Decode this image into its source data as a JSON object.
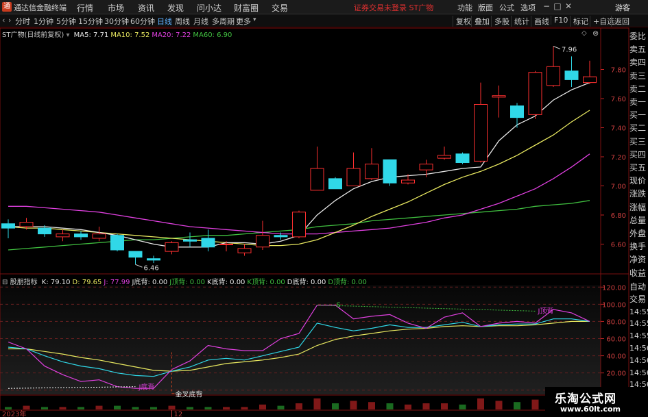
{
  "titlebar": {
    "app_title": "通达信金融终端",
    "menu": [
      "行情",
      "市场",
      "资讯",
      "发现",
      "问小达",
      "财富圈",
      "交易"
    ],
    "warning": "证券交易未登录  ST广物",
    "right_menu": [
      "功能",
      "版面",
      "公式",
      "选项"
    ],
    "guest": "游客"
  },
  "period_bar": {
    "periods": [
      "分时",
      "1分钟",
      "5分钟",
      "15分钟",
      "30分钟",
      "60分钟",
      "日线",
      "周线",
      "月线",
      "多周期",
      "更多"
    ],
    "active_period": "日线",
    "right_buttons": [
      "复权",
      "叠加",
      "多股",
      "统计",
      "画线",
      "F10",
      "标记",
      "+自选",
      "返回"
    ]
  },
  "main_chart": {
    "stock_label": "ST广物(日线前复权)",
    "ma": [
      {
        "label": "MA5:",
        "value": "7.71",
        "color": "#e8e8e8"
      },
      {
        "label": "MA10:",
        "value": "7.52",
        "color": "#e8e860"
      },
      {
        "label": "MA20:",
        "value": "7.22",
        "color": "#e040e0"
      },
      {
        "label": "MA60:",
        "value": "6.90",
        "color": "#40c040"
      }
    ],
    "y_ticks": [
      "7.80",
      "7.60",
      "7.40",
      "7.20",
      "7.00",
      "6.80",
      "6.60"
    ],
    "high_label": "7.96",
    "low_label": "6.46"
  },
  "indicator": {
    "name": "股朋指标",
    "values": [
      {
        "label": "K:",
        "value": "79.10",
        "color": "#e8e8e8"
      },
      {
        "label": "D:",
        "value": "79.65",
        "color": "#e8e860"
      },
      {
        "label": "J:",
        "value": "77.99",
        "color": "#e040e0"
      },
      {
        "label": "J底背:",
        "value": "0.00",
        "color": "#e8e8e8"
      },
      {
        "label": "J顶背:",
        "value": "0.00",
        "color": "#40c040"
      },
      {
        "label": "K底背:",
        "value": "0.00",
        "color": "#e8e8e8"
      },
      {
        "label": "K顶背:",
        "value": "0.00",
        "color": "#40c040"
      },
      {
        "label": "D底背:",
        "value": "0.00",
        "color": "#e8e8e8"
      },
      {
        "label": "D顶背:",
        "value": "0.00",
        "color": "#40c040"
      }
    ],
    "y_ticks": [
      "120.00",
      "100.00",
      "80.00",
      "60.00",
      "40.00",
      "20.00",
      "0.00"
    ],
    "annotations": {
      "bottom_div": "J底背",
      "golden_cross": "金叉底背",
      "top_div": "J顶背",
      "s_mark": "S"
    }
  },
  "x_axis": {
    "labels": [
      "2023年",
      "12"
    ]
  },
  "right_panel": {
    "top_items": [
      "委比",
      "卖五",
      "卖四",
      "卖三",
      "卖二",
      "卖一",
      "买一",
      "买二",
      "买三",
      "买四",
      "买五",
      "现价",
      "涨跌",
      "涨幅",
      "总量",
      "外盘",
      "换手",
      "净资",
      "收益"
    ],
    "bottom_items": [
      "自动",
      "交易",
      "14:55",
      "14:55",
      "14:55",
      "14:56",
      "14:56",
      "14:56",
      "14:56",
      "14:56"
    ]
  },
  "watermark": {
    "line1": "乐淘公式网",
    "line2": "www.60lt.com"
  },
  "colors": {
    "up": "#ff3030",
    "down": "#30d8e8",
    "ma5": "#e8e8e8",
    "ma10": "#e8e860",
    "ma20": "#e040e0",
    "ma60": "#40c040"
  },
  "chart_data": {
    "type": "candlestick",
    "price_axis": [
      6.4,
      8.0
    ],
    "candles": [
      {
        "o": 6.74,
        "c": 6.71,
        "h": 6.77,
        "l": 6.64
      },
      {
        "o": 6.72,
        "c": 6.75,
        "h": 6.78,
        "l": 6.7
      },
      {
        "o": 6.71,
        "c": 6.67,
        "h": 6.73,
        "l": 6.65
      },
      {
        "o": 6.65,
        "c": 6.67,
        "h": 6.7,
        "l": 6.62
      },
      {
        "o": 6.67,
        "c": 6.65,
        "h": 6.69,
        "l": 6.63
      },
      {
        "o": 6.64,
        "c": 6.67,
        "h": 6.72,
        "l": 6.62
      },
      {
        "o": 6.66,
        "c": 6.56,
        "h": 6.67,
        "l": 6.55
      },
      {
        "o": 6.55,
        "c": 6.51,
        "h": 6.55,
        "l": 6.46
      },
      {
        "o": 6.5,
        "c": 6.49,
        "h": 6.52,
        "l": 6.47
      },
      {
        "o": 6.55,
        "c": 6.61,
        "h": 6.62,
        "l": 6.53
      },
      {
        "o": 6.63,
        "c": 6.62,
        "h": 6.68,
        "l": 6.58
      },
      {
        "o": 6.64,
        "c": 6.58,
        "h": 6.7,
        "l": 6.55
      },
      {
        "o": 6.6,
        "c": 6.6,
        "h": 6.62,
        "l": 6.55
      },
      {
        "o": 6.54,
        "c": 6.57,
        "h": 6.6,
        "l": 6.52
      },
      {
        "o": 6.58,
        "c": 6.66,
        "h": 6.76,
        "l": 6.56
      },
      {
        "o": 6.66,
        "c": 6.65,
        "h": 6.68,
        "l": 6.63
      },
      {
        "o": 6.65,
        "c": 6.82,
        "h": 6.83,
        "l": 6.64
      },
      {
        "o": 6.97,
        "c": 7.12,
        "h": 7.27,
        "l": 6.97
      },
      {
        "o": 7.05,
        "c": 6.98,
        "h": 7.06,
        "l": 6.98
      },
      {
        "o": 7.0,
        "c": 7.12,
        "h": 7.23,
        "l": 7.0
      },
      {
        "o": 7.05,
        "c": 7.15,
        "h": 7.26,
        "l": 7.04
      },
      {
        "o": 7.18,
        "c": 7.02,
        "h": 7.18,
        "l": 7.0
      },
      {
        "o": 7.02,
        "c": 7.04,
        "h": 7.08,
        "l": 7.01
      },
      {
        "o": 7.11,
        "c": 7.15,
        "h": 7.18,
        "l": 7.06
      },
      {
        "o": 7.19,
        "c": 7.21,
        "h": 7.27,
        "l": 7.18
      },
      {
        "o": 7.22,
        "c": 7.16,
        "h": 7.23,
        "l": 7.15
      },
      {
        "o": 7.17,
        "c": 7.56,
        "h": 7.71,
        "l": 7.16
      },
      {
        "o": 7.61,
        "c": 7.62,
        "h": 7.69,
        "l": 7.47
      },
      {
        "o": 7.55,
        "c": 7.47,
        "h": 7.57,
        "l": 7.4
      },
      {
        "o": 7.49,
        "c": 7.78,
        "h": 7.79,
        "l": 7.46
      },
      {
        "o": 7.69,
        "c": 7.82,
        "h": 7.96,
        "l": 7.68
      },
      {
        "o": 7.79,
        "c": 7.73,
        "h": 7.89,
        "l": 7.68
      },
      {
        "o": 7.71,
        "c": 7.75,
        "h": 7.86,
        "l": 7.7
      }
    ],
    "ma5": [
      6.72,
      6.72,
      6.72,
      6.71,
      6.7,
      6.68,
      6.66,
      6.63,
      6.6,
      6.58,
      6.58,
      6.58,
      6.61,
      6.61,
      6.6,
      6.62,
      6.66,
      6.8,
      6.9,
      6.98,
      7.03,
      7.06,
      7.07,
      7.08,
      7.1,
      7.12,
      7.13,
      7.31,
      7.42,
      7.48,
      7.59,
      7.66,
      7.71
    ],
    "ma10": [
      6.72,
      6.71,
      6.71,
      6.7,
      6.69,
      6.68,
      6.67,
      6.66,
      6.65,
      6.64,
      6.63,
      6.62,
      6.61,
      6.6,
      6.59,
      6.59,
      6.6,
      6.63,
      6.68,
      6.73,
      6.79,
      6.84,
      6.89,
      6.95,
      7.01,
      7.06,
      7.1,
      7.15,
      7.21,
      7.28,
      7.35,
      7.44,
      7.52
    ],
    "ma20": [
      6.86,
      6.86,
      6.85,
      6.84,
      6.83,
      6.82,
      6.8,
      6.78,
      6.76,
      6.74,
      6.72,
      6.71,
      6.7,
      6.69,
      6.68,
      6.67,
      6.67,
      6.67,
      6.68,
      6.69,
      6.7,
      6.71,
      6.73,
      6.75,
      6.78,
      6.8,
      6.84,
      6.88,
      6.93,
      6.98,
      7.05,
      7.13,
      7.22
    ],
    "ma60": [
      6.56,
      6.57,
      6.58,
      6.59,
      6.6,
      6.61,
      6.62,
      6.63,
      6.63,
      6.64,
      6.65,
      6.66,
      6.66,
      6.67,
      6.68,
      6.69,
      6.7,
      6.72,
      6.73,
      6.74,
      6.76,
      6.77,
      6.78,
      6.79,
      6.8,
      6.81,
      6.82,
      6.83,
      6.84,
      6.86,
      6.87,
      6.88,
      6.9
    ],
    "kdj_axis": [
      -5,
      125
    ],
    "kdj_k": [
      50,
      48,
      40,
      33,
      28,
      25,
      20,
      17,
      16,
      22,
      27,
      35,
      37,
      35,
      40,
      45,
      50,
      78,
      73,
      69,
      72,
      76,
      73,
      73,
      76,
      79,
      74,
      76,
      77,
      77,
      83,
      83,
      80
    ],
    "kdj_d": [
      48,
      48,
      45,
      42,
      38,
      35,
      31,
      27,
      23,
      22,
      23,
      27,
      31,
      33,
      35,
      38,
      42,
      52,
      59,
      63,
      66,
      69,
      71,
      72,
      74,
      75,
      74,
      75,
      75,
      76,
      78,
      80,
      80
    ],
    "kdj_j": [
      56,
      48,
      28,
      18,
      10,
      12,
      4,
      2,
      2,
      24,
      34,
      52,
      48,
      46,
      46,
      60,
      66,
      99,
      99,
      83,
      86,
      88,
      78,
      72,
      85,
      90,
      74,
      78,
      80,
      78,
      94,
      90,
      80
    ],
    "volume": [
      0.2,
      0.3,
      0.2,
      0.2,
      0.2,
      0.3,
      0.3,
      0.2,
      0.2,
      0.3,
      0.2,
      0.2,
      0.2,
      0.2,
      0.4,
      0.3,
      0.5,
      0.9,
      0.5,
      0.7,
      0.6,
      0.5,
      0.4,
      0.5,
      0.5,
      0.4,
      0.9,
      0.7,
      0.6,
      0.8,
      0.8,
      0.6,
      0.5
    ]
  }
}
